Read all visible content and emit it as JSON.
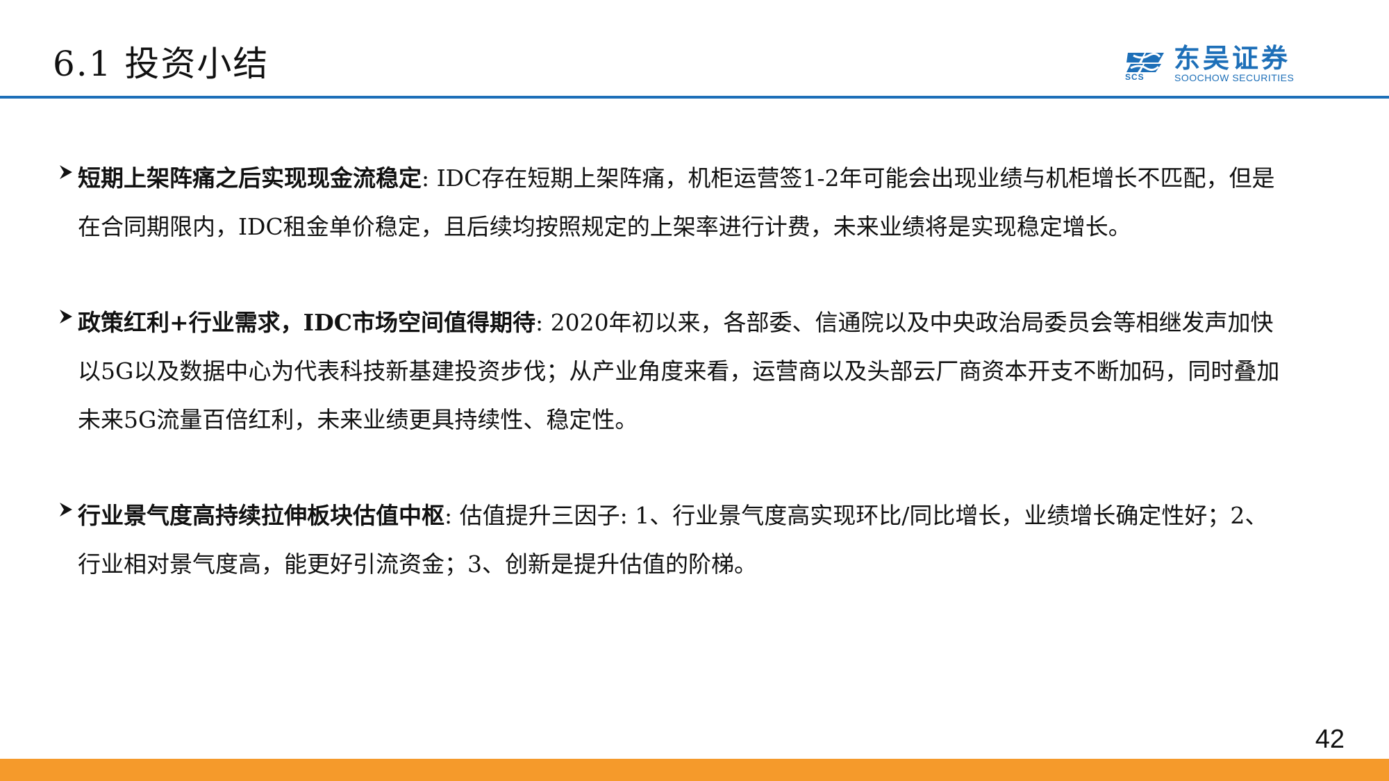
{
  "header": {
    "title": "6.1 投资小结",
    "logo": {
      "name_cn": "东吴证券",
      "name_en": "SOOCHOW SECURITIES",
      "abbr": "SCS",
      "color": "#1d6fb8"
    }
  },
  "bullets": [
    {
      "heading": "短期上架阵痛之后实现现金流稳定",
      "text": ": IDC存在短期上架阵痛，机柜运营签1-2年可能会出现业绩与机柜增长不匹配，但是在合同期限内，IDC租金单价稳定，且后续均按照规定的上架率进行计费，未来业绩将是实现稳定增长。"
    },
    {
      "heading": "政策红利+行业需求，IDC市场空间值得期待",
      "text": ": 2020年初以来，各部委、信通院以及中央政治局委员会等相继发声加快以5G以及数据中心为代表科技新基建投资步伐；从产业角度来看，运营商以及头部云厂商资本开支不断加码，同时叠加未来5G流量百倍红利，未来业绩更具持续性、稳定性。"
    },
    {
      "heading": "行业景气度高持续拉伸板块估值中枢",
      "text": ": 估值提升三因子: 1、行业景气度高实现环比/同比增长，业绩增长确定性好；2、行业相对景气度高，能更好引流资金；3、创新是提升估值的阶梯。"
    }
  ],
  "footer": {
    "page_number": "42",
    "accent_color": "#f59a2b"
  }
}
